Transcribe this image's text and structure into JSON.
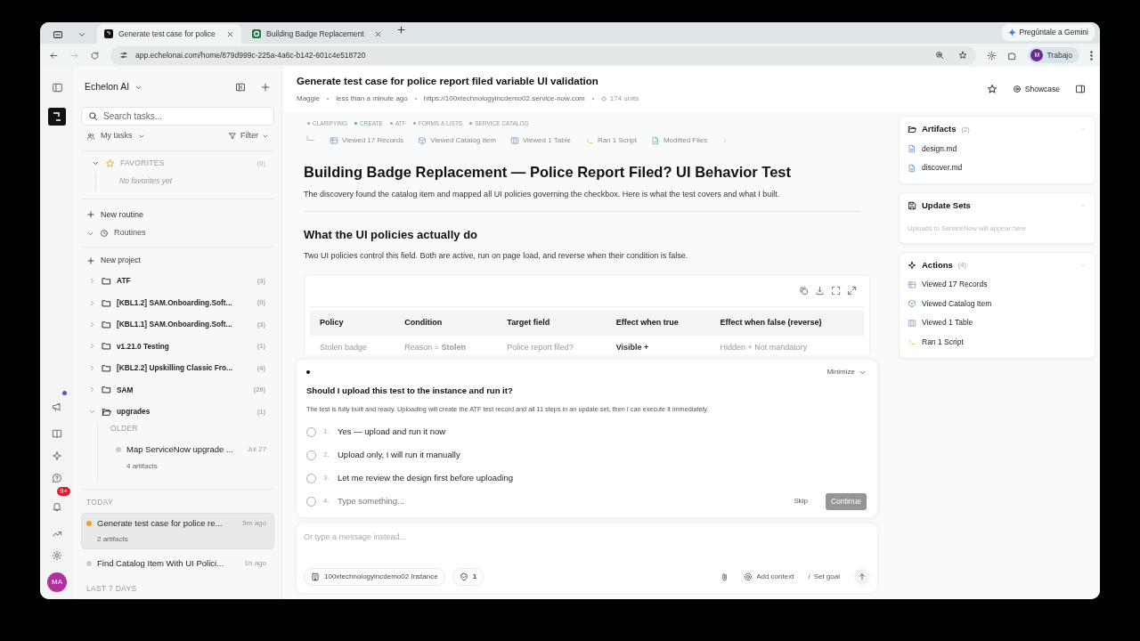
{
  "browser": {
    "tabs": [
      {
        "title": "Generate test case for police",
        "selected": true
      },
      {
        "title": "Building Badge Replacement",
        "selected": false
      }
    ],
    "gemini_button": "Pregúntale a Gemini",
    "url": "app.echelonai.com/home/879d999c-225a-4a6c-b142-601c4e518720",
    "profile": {
      "initial": "M",
      "label": "Trabajo"
    }
  },
  "rail": {
    "notification_badge": "9+",
    "has_announcement": true,
    "avatar": "MA"
  },
  "sidebar": {
    "workspace": "Echelon AI",
    "search_placeholder": "Search tasks...",
    "my_tasks": "My tasks",
    "filter": "Filter",
    "favorites": {
      "label": "FAVORITES",
      "count": "(0)",
      "expanded": true,
      "empty": "No favorites yet"
    },
    "new_routine": "New routine",
    "routines": {
      "label": "Routines",
      "expanded": true
    },
    "new_project": "New project",
    "projects": [
      {
        "name": "ATF",
        "count": "(3)",
        "expanded": false
      },
      {
        "name": "[KBL1.2] SAM.Onboarding.Soft...",
        "count": "(0)",
        "expanded": false
      },
      {
        "name": "[KBL1.1] SAM.Onboarding.Soft...",
        "count": "(3)",
        "expanded": false
      },
      {
        "name": "v1.21.0 Testing",
        "count": "(1)",
        "expanded": false
      },
      {
        "name": "[KBL2.2] Upskilling Classic Fro...",
        "count": "(4)",
        "expanded": false
      },
      {
        "name": "SAM",
        "count": "(29)",
        "expanded": false
      },
      {
        "name": "upgrades",
        "count": "(1)",
        "expanded": true,
        "groups": [
          {
            "label": "OLDER",
            "tasks": [
              {
                "title": "Map ServiceNow upgrade ...",
                "time": "Jul 27",
                "artifacts": "4 artifacts",
                "color": "#cccccc",
                "selected": false
              }
            ]
          }
        ]
      }
    ],
    "task_groups": [
      {
        "label": "TODAY",
        "tasks": [
          {
            "title": "Generate test case for police re...",
            "time": "5m ago",
            "artifacts": "2 artifacts",
            "color": "#f0a030",
            "selected": true
          },
          {
            "title": "Find Catalog Item With UI Polici...",
            "time": "1h ago",
            "color": "#cccccc",
            "selected": false
          }
        ]
      },
      {
        "label": "LAST 7 DAYS"
      }
    ]
  },
  "header": {
    "title": "Generate test case for police report filed variable UI validation",
    "meta": [
      "Maggie",
      "less than a minute ago",
      "https://100xtechnologyincdemo02.service-now.com"
    ],
    "units": "174 units",
    "showcase": "Showcase"
  },
  "content": {
    "tags": [
      {
        "label": "CLARIFYING",
        "color": "#9aa5b8"
      },
      {
        "label": "CREATE",
        "color": "#3cb878"
      },
      {
        "label": "ATF",
        "color": "#9aa5b8"
      },
      {
        "label": "FORMS & LISTS",
        "color": "#9aa5b8"
      },
      {
        "label": "SERVICE CATALOG",
        "color": "#9aa5b8"
      }
    ],
    "actions": [
      {
        "label": "Viewed 17 Records",
        "kind": "records"
      },
      {
        "label": "Viewed Catalog Item",
        "kind": "catalog"
      },
      {
        "label": "Viewed 1 Table",
        "kind": "table"
      },
      {
        "label": "Ran 1 Script",
        "kind": "script"
      },
      {
        "label": "Modified Files",
        "kind": "files"
      }
    ],
    "heading": "Building Badge Replacement — Police Report Filed? UI Behavior Test",
    "intro": "The discovery found the catalog item and mapped all UI policies governing the checkbox. Here is what the test covers and what I built.",
    "section_heading": "What the UI policies actually do",
    "section_text": "Two UI policies control this field. Both are active, run on page load, and reverse when their condition is false.",
    "table": {
      "columns": [
        "Policy",
        "Condition",
        "Target field",
        "Effect when true",
        "Effect when false (reverse)"
      ],
      "rows": [
        [
          "Stolen badge",
          "Reason = **Stolen**",
          "Police report filed?",
          "Visible +",
          "Hidden + Not mandatory"
        ]
      ]
    }
  },
  "question": {
    "minimize": "Minimize",
    "text": "Should I upload this test to the instance and run it?",
    "detail": "The test is fully built and ready. Uploading will create the ATF test record and all 11 steps in an update set, then I can execute it immediately.",
    "options": [
      {
        "number": "1.",
        "label": "Yes — upload and run it now",
        "selected": false
      },
      {
        "number": "2.",
        "label": "Upload only, I will run it manually",
        "selected": false
      },
      {
        "number": "3.",
        "label": "Let me review the design first before uploading",
        "selected": false
      }
    ],
    "custom": {
      "number": "4.",
      "placeholder": "Type something...",
      "selected": false
    },
    "skip": "Skip",
    "continue": {
      "label": "Continue",
      "disabled": true
    }
  },
  "composer": {
    "placeholder": "Or type a message instead...",
    "instance": "100xtechnologyincdemo02 Instance",
    "checks": "1",
    "add_context": "Add context",
    "goal_prefix": "/",
    "set_goal": "Set goal"
  },
  "panel": {
    "artifacts": {
      "title": "Artifacts",
      "count": "(2)",
      "files": [
        "design.md",
        "discover.md"
      ]
    },
    "update_sets": {
      "title": "Update Sets",
      "empty": "Uploads to ServiceNow will appear here"
    },
    "actions": {
      "title": "Actions",
      "count": "(4)",
      "items": [
        {
          "label": "Viewed 17 Records",
          "kind": "records"
        },
        {
          "label": "Viewed Catalog Item",
          "kind": "catalog"
        },
        {
          "label": "Viewed 1 Table",
          "kind": "table"
        },
        {
          "label": "Ran 1 Script",
          "kind": "script"
        }
      ]
    }
  }
}
